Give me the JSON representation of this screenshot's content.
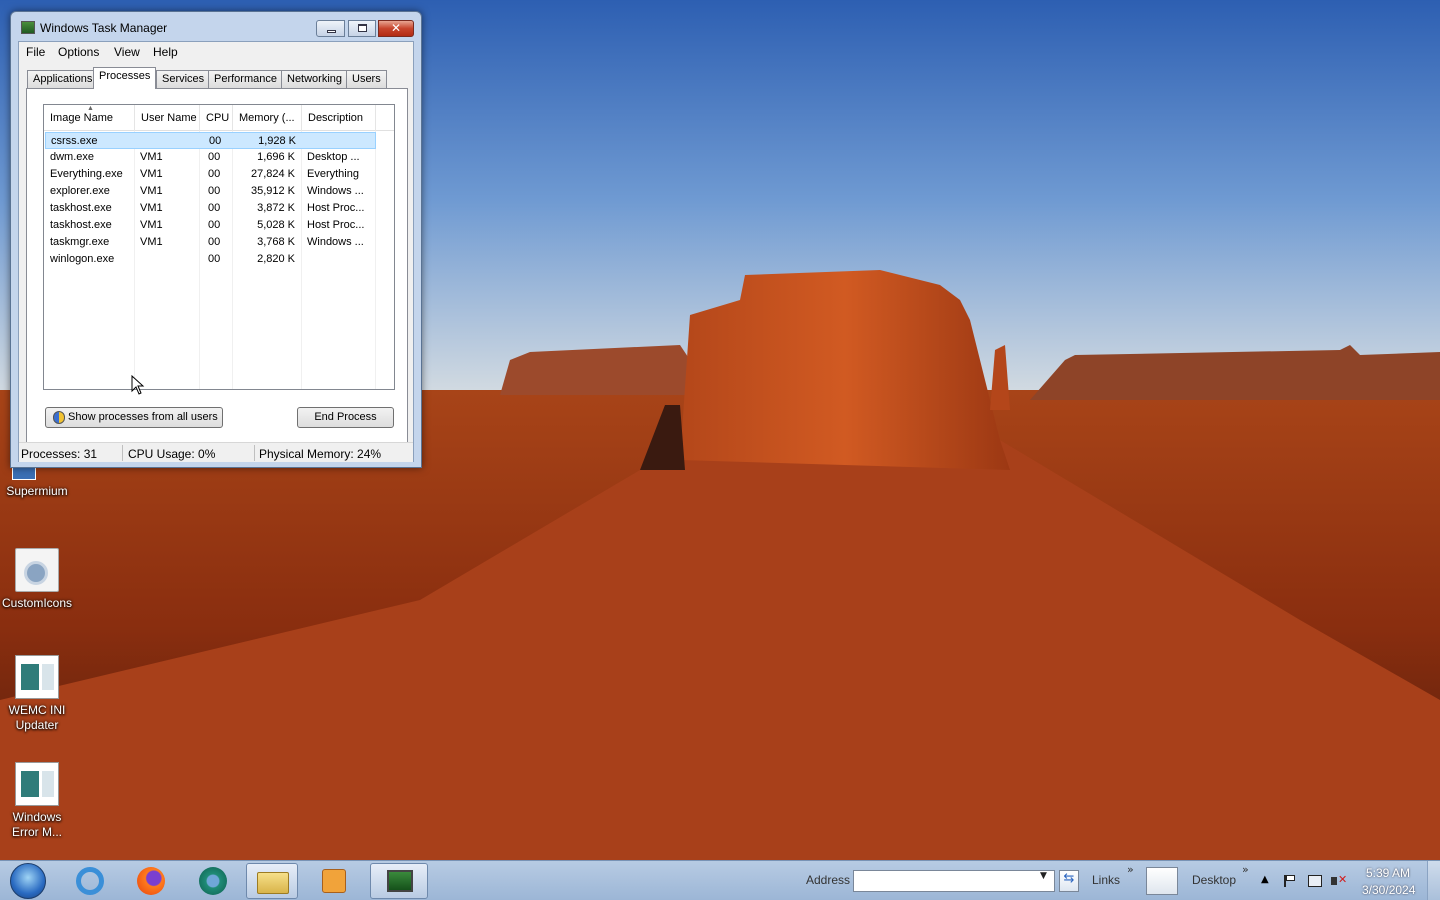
{
  "window": {
    "title": "Windows Task Manager",
    "close_glyph": "✕"
  },
  "menu": [
    "File",
    "Options",
    "View",
    "Help"
  ],
  "tabs": [
    "Applications",
    "Processes",
    "Services",
    "Performance",
    "Networking",
    "Users"
  ],
  "active_tab": "Processes",
  "process_table": {
    "columns": [
      "Image Name",
      "User Name",
      "CPU",
      "Memory (...",
      "Description"
    ],
    "sort_column": "Image Name",
    "rows": [
      {
        "image": "csrss.exe",
        "user": "",
        "cpu": "00",
        "memory": "1,928 K",
        "description": ""
      },
      {
        "image": "dwm.exe",
        "user": "VM1",
        "cpu": "00",
        "memory": "1,696 K",
        "description": "Desktop ..."
      },
      {
        "image": "Everything.exe",
        "user": "VM1",
        "cpu": "00",
        "memory": "27,824 K",
        "description": "Everything"
      },
      {
        "image": "explorer.exe",
        "user": "VM1",
        "cpu": "00",
        "memory": "35,912 K",
        "description": "Windows ..."
      },
      {
        "image": "taskhost.exe",
        "user": "VM1",
        "cpu": "00",
        "memory": "3,872 K",
        "description": "Host Proc..."
      },
      {
        "image": "taskhost.exe",
        "user": "VM1",
        "cpu": "00",
        "memory": "5,028 K",
        "description": "Host Proc..."
      },
      {
        "image": "taskmgr.exe",
        "user": "VM1",
        "cpu": "00",
        "memory": "3,768 K",
        "description": "Windows ..."
      },
      {
        "image": "winlogon.exe",
        "user": "",
        "cpu": "00",
        "memory": "2,820 K",
        "description": ""
      }
    ],
    "selected_row": 0
  },
  "buttons": {
    "show_all": "Show processes from all users",
    "end_process": "End Process"
  },
  "status": {
    "processes": "Processes: 31",
    "cpu": "CPU Usage: 0%",
    "memory": "Physical Memory: 24%"
  },
  "desktop_icons": [
    {
      "label": "Supermium",
      "icon": "supermium-icon"
    },
    {
      "label": "CustomIcons",
      "icon": "customicons-icon"
    },
    {
      "label": "WEMC INI Updater",
      "icon": "wemc-ini-updater-icon"
    },
    {
      "label": "Windows Error M...",
      "icon": "windows-error-icon"
    }
  ],
  "taskbar": {
    "pinned": [
      "start-orb-icon",
      "internet-explorer-icon",
      "firefox-icon",
      "chromium-icon",
      "file-explorer-icon",
      "media-player-icon",
      "task-manager-icon"
    ],
    "address_label": "Address",
    "address_value": "",
    "links_label": "Links",
    "desktop_label": "Desktop",
    "chevron": "»",
    "clock_time": "5:39 AM",
    "clock_date": "3/30/2024"
  },
  "colors": {
    "selection": "#cce8ff",
    "taskbar": "#a9c0dc",
    "window_frame": "#c4d5ec"
  }
}
